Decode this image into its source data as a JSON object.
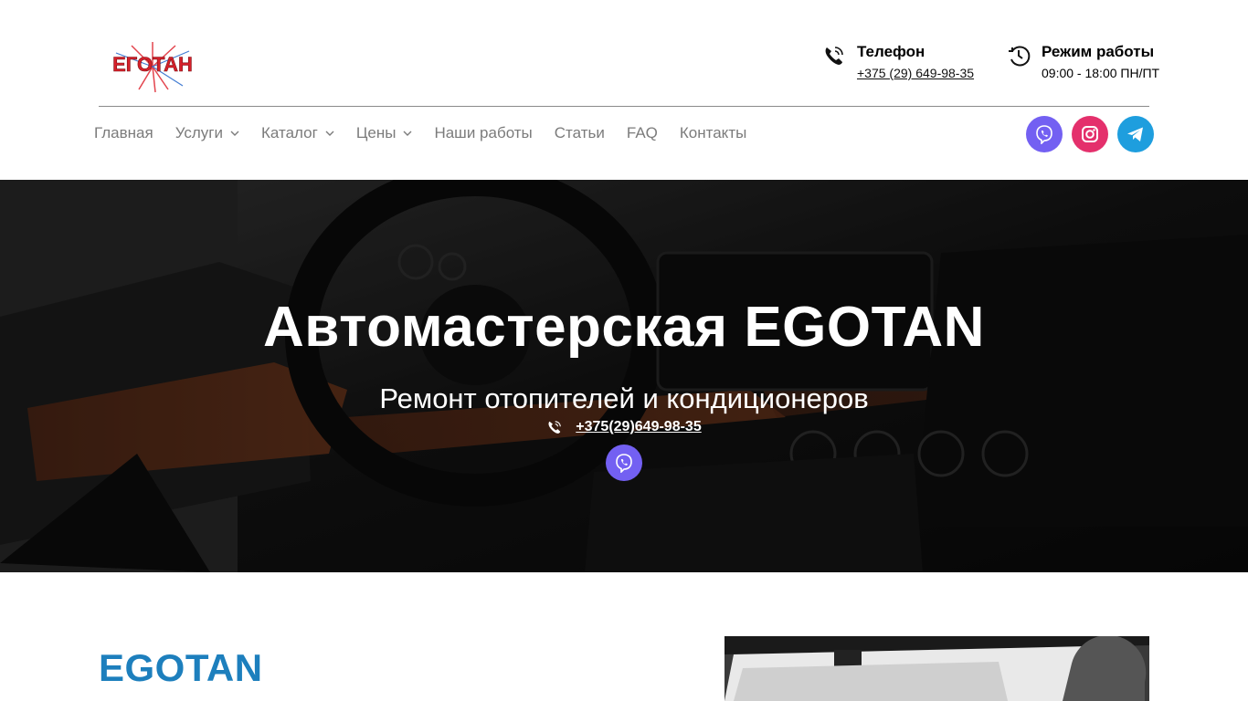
{
  "logo": {
    "text": "ЕГОТАН"
  },
  "contacts": {
    "phone": {
      "title": "Телефон",
      "value": "+375 (29) 649-98-35"
    },
    "hours": {
      "title": "Режим работы",
      "value": "09:00 - 18:00 ПН/ПТ"
    }
  },
  "nav": {
    "items": [
      {
        "label": "Главная",
        "dropdown": false
      },
      {
        "label": "Услуги",
        "dropdown": true
      },
      {
        "label": "Каталог",
        "dropdown": true
      },
      {
        "label": "Цены",
        "dropdown": true
      },
      {
        "label": "Наши работы",
        "dropdown": false
      },
      {
        "label": "Статьи",
        "dropdown": false
      },
      {
        "label": "FAQ",
        "dropdown": false
      },
      {
        "label": "Контакты",
        "dropdown": false
      }
    ]
  },
  "socials": [
    {
      "icon": "viber-icon",
      "color": "#7360f2"
    },
    {
      "icon": "instagram-icon",
      "color": "#e4306c"
    },
    {
      "icon": "telegram-icon",
      "color": "#1e9ede"
    }
  ],
  "hero": {
    "title": "Автомастерская EGOTAN",
    "subtitle": "Ремонт отопителей и кондиционеров",
    "phone": "+375(29)649-98-35",
    "viber_color": "#7360f2"
  },
  "section": {
    "title": "EGOTAN",
    "title_color": "#1d7fbd"
  },
  "colors": {
    "nav_text": "#7b7b7b",
    "divider": "#8a8a8a"
  }
}
